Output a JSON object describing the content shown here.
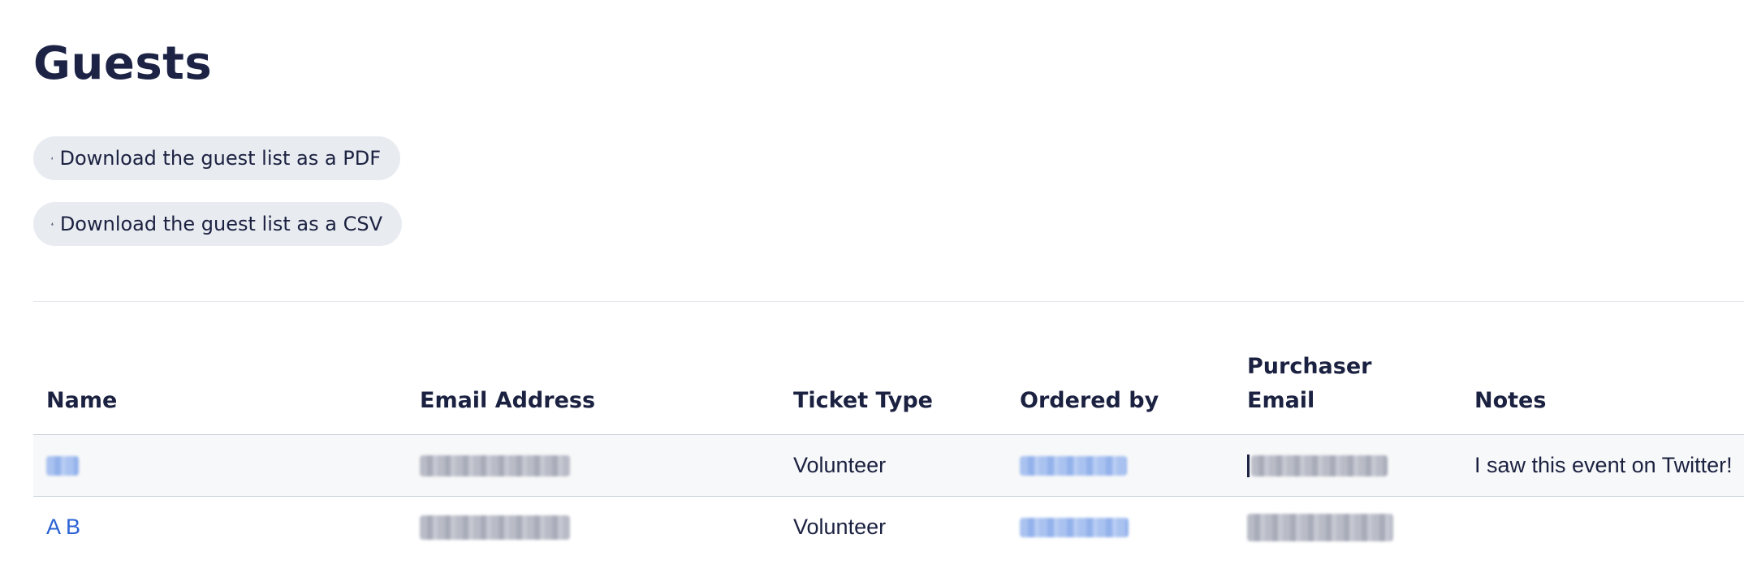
{
  "page": {
    "title": "Guests"
  },
  "downloads": {
    "pdf_label": "Download the guest list as a PDF",
    "csv_label": "Download the guest list as a CSV",
    "icon": "download-icon"
  },
  "table": {
    "headers": {
      "name": "Name",
      "email": "Email Address",
      "ticket_type": "Ticket Type",
      "ordered_by": "Ordered by",
      "purchaser_email_line1": "Purchaser",
      "purchaser_email_line2": "Email",
      "notes": "Notes"
    },
    "rows": [
      {
        "name": "",
        "email": "",
        "ticket_type": "Volunteer",
        "ordered_by": "",
        "purchaser_email": "",
        "notes": "I saw this event on Twitter!"
      },
      {
        "name": "A B",
        "email": "",
        "ticket_type": "Volunteer",
        "ordered_by": "",
        "purchaser_email": "",
        "notes": ""
      }
    ]
  },
  "colors": {
    "text": "#1b2140",
    "link": "#2a62d4",
    "button_bg": "#e8ebf0",
    "row_alt_bg": "#f7f8f9",
    "border": "#c9d0da"
  }
}
